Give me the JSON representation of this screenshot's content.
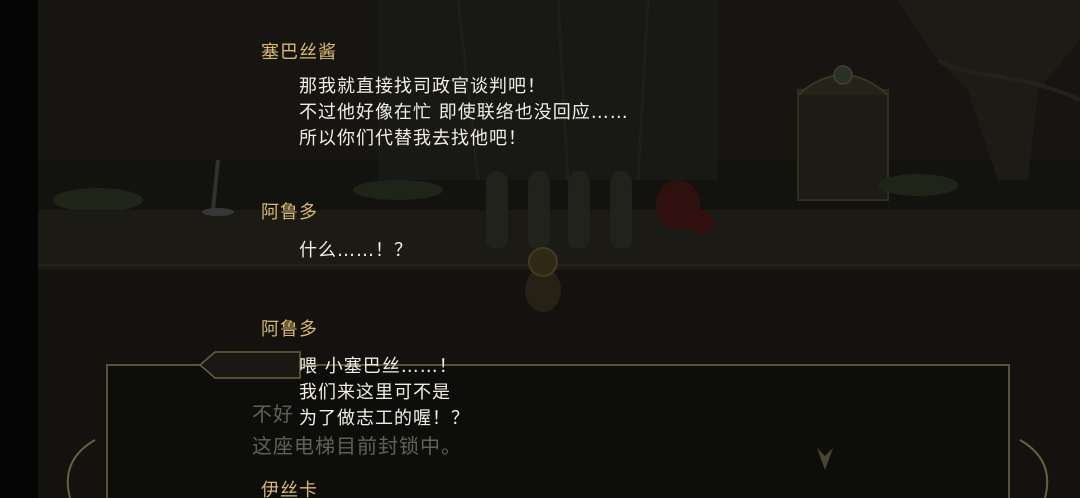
{
  "dialogue": [
    {
      "speaker": "塞巴丝酱",
      "lines": [
        "那我就直接找司政官谈判吧！",
        "不过他好像在忙 即使联络也没回应……",
        "所以你们代替我去找他吧！"
      ]
    },
    {
      "speaker": "阿鲁多",
      "lines": [
        "什么……！？"
      ]
    },
    {
      "speaker": "阿鲁多",
      "lines": [
        "喂 小塞巴丝……！",
        "我们来这里可不是",
        "为了做志工的喔！？"
      ]
    },
    {
      "speaker": "伊丝卡",
      "lines": []
    }
  ],
  "background_box": {
    "line1": "不好",
    "line2": "这座电梯目前封锁中。"
  },
  "colors": {
    "speaker": "#d9b872",
    "text": "#f1ede4",
    "overlay": "rgba(0,0,0,0.35)"
  }
}
